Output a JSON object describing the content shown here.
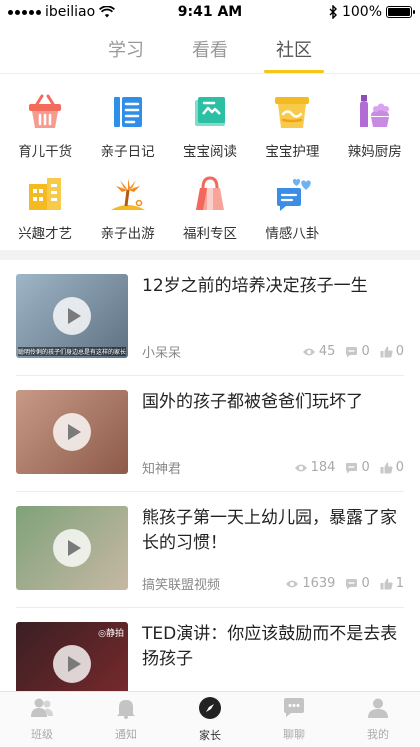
{
  "status": {
    "carrier": "ibeiliao",
    "time": "9:41 AM",
    "battery": "100%",
    "battery_level": 1.0
  },
  "top_tabs": [
    {
      "label": "学习"
    },
    {
      "label": "看看"
    },
    {
      "label": "社区",
      "active": true
    }
  ],
  "categories": [
    {
      "label": "育儿干货",
      "icon": "basket-icon",
      "color": "#f26b5b"
    },
    {
      "label": "亲子日记",
      "icon": "diary-icon",
      "color": "#2f8fe8"
    },
    {
      "label": "宝宝阅读",
      "icon": "book-icon",
      "color": "#2bbfa4"
    },
    {
      "label": "宝宝护理",
      "icon": "basin-icon",
      "color": "#f5b922"
    },
    {
      "label": "辣妈厨房",
      "icon": "kitchen-icon",
      "color": "#b36bd6"
    },
    {
      "label": "兴趣才艺",
      "icon": "building-icon",
      "color": "#f5b922"
    },
    {
      "label": "亲子出游",
      "icon": "palm-tree-icon",
      "color": "#f58a1f"
    },
    {
      "label": "福利专区",
      "icon": "gift-bag-icon",
      "color": "#f2685b"
    },
    {
      "label": "情感八卦",
      "icon": "chat-hearts-icon",
      "color": "#3a8ee6"
    }
  ],
  "feed": [
    {
      "title": "12岁之前的培养决定孩子一生",
      "author": "小呆呆",
      "views": "45",
      "comments": "0",
      "likes": "0",
      "thumb_caption": "聪明伶俐的孩子们身边总是有这样的家长",
      "thumb_colors": [
        "#9fb6c7",
        "#5e7183"
      ]
    },
    {
      "title": "国外的孩子都被爸爸们玩坏了",
      "author": "知神君",
      "views": "184",
      "comments": "0",
      "likes": "0",
      "thumb_colors": [
        "#c79a86",
        "#8e5a4a"
      ]
    },
    {
      "title": "熊孩子第一天上幼儿园，暴露了家长的习惯！",
      "author": "搞笑联盟视频",
      "views": "1639",
      "comments": "0",
      "likes": "1",
      "thumb_colors": [
        "#7fa27a",
        "#c7b8a4"
      ]
    },
    {
      "title": "TED演讲：你应该鼓励而不是去表扬孩子",
      "author": "",
      "views": "",
      "comments": "",
      "likes": "",
      "thumb_mark": "◎静拍",
      "thumb_colors": [
        "#3a1f22",
        "#7a2a2e"
      ]
    }
  ],
  "bottom_nav": [
    {
      "label": "班级",
      "icon": "class-icon"
    },
    {
      "label": "通知",
      "icon": "bell-icon"
    },
    {
      "label": "家长",
      "icon": "compass-icon",
      "active": true
    },
    {
      "label": "聊聊",
      "icon": "chat-icon"
    },
    {
      "label": "我的",
      "icon": "profile-icon"
    }
  ]
}
